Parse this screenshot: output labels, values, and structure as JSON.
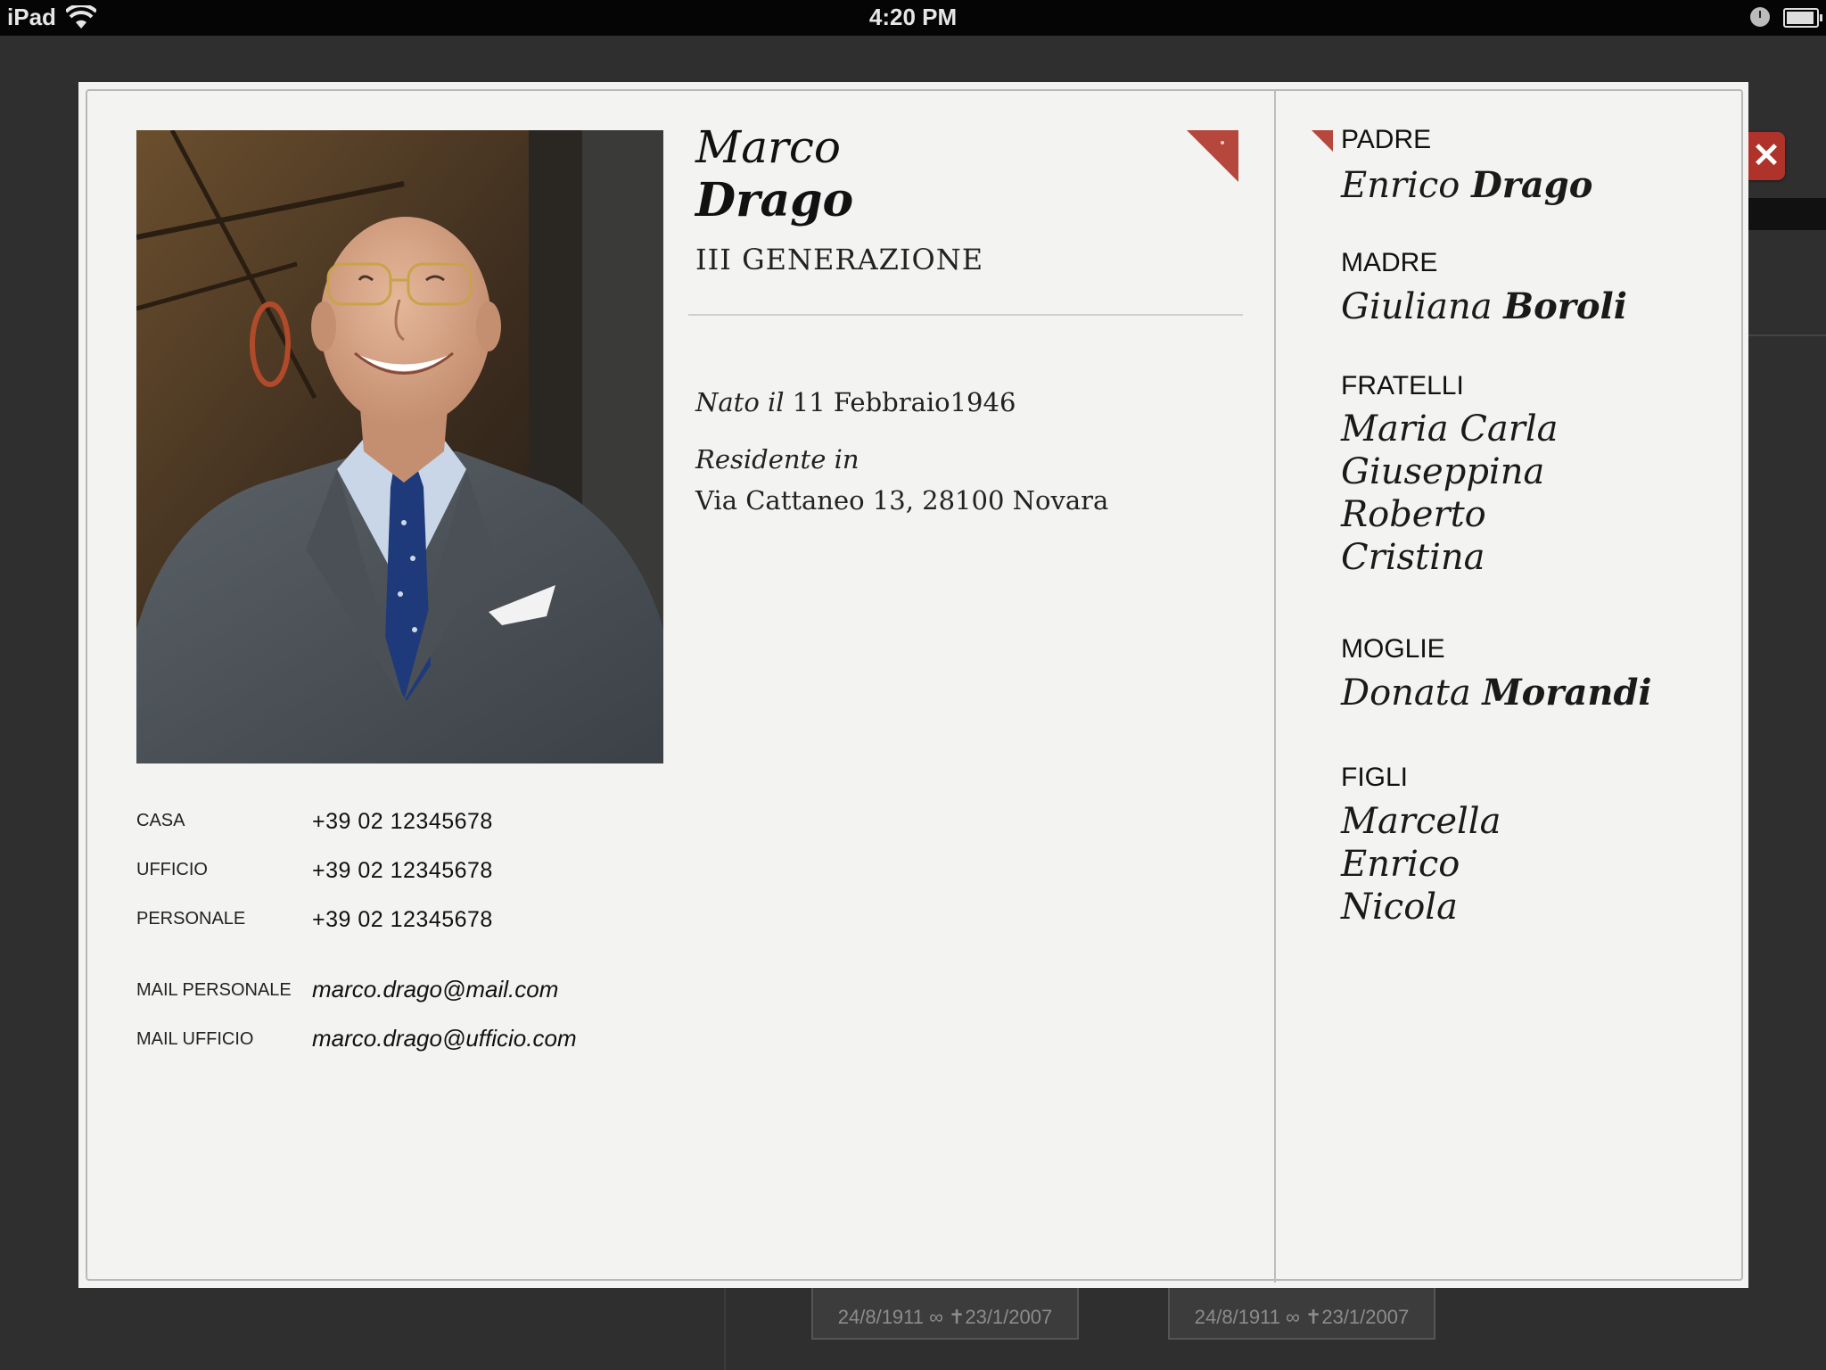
{
  "status_bar": {
    "device": "iPad",
    "time": "4:20 PM"
  },
  "background": {
    "card_1": "24/8/1911 ∞ ✝23/1/2007",
    "card_2": "24/8/1911 ∞ ✝23/1/2007"
  },
  "close_icon": "✕",
  "person": {
    "first_name": "Marco",
    "last_name": "Drago",
    "generation": "III GENERAZIONE",
    "born_label": "Nato il",
    "born_date": "11 Febbraio1946",
    "residence_label": "Residente in",
    "address": "Via Cattaneo 13, 28100 Novara"
  },
  "contacts": {
    "casa_label": "CASA",
    "casa": "+39 02 12345678",
    "ufficio_label": "UFFICIO",
    "ufficio": "+39 02 12345678",
    "personale_label": "PERSONALE",
    "personale": "+39 02 12345678",
    "mail_personale_label": "MAIL PERSONALE",
    "mail_personale": "marco.drago@mail.com",
    "mail_ufficio_label": "MAIL UFFICIO",
    "mail_ufficio": "marco.drago@ufficio.com"
  },
  "family": {
    "padre_label": "PADRE",
    "padre_first": "Enrico",
    "padre_last": "Drago",
    "madre_label": "MADRE",
    "madre_first": "Giuliana",
    "madre_last": "Boroli",
    "fratelli_label": "FRATELLI",
    "fratelli": [
      "Maria Carla",
      "Giuseppina",
      "Roberto",
      "Cristina"
    ],
    "moglie_label": "MOGLIE",
    "moglie_first": "Donata",
    "moglie_last": "Morandi",
    "figli_label": "FIGLI",
    "figli": [
      "Marcella",
      "Enrico",
      "Nicola"
    ]
  }
}
